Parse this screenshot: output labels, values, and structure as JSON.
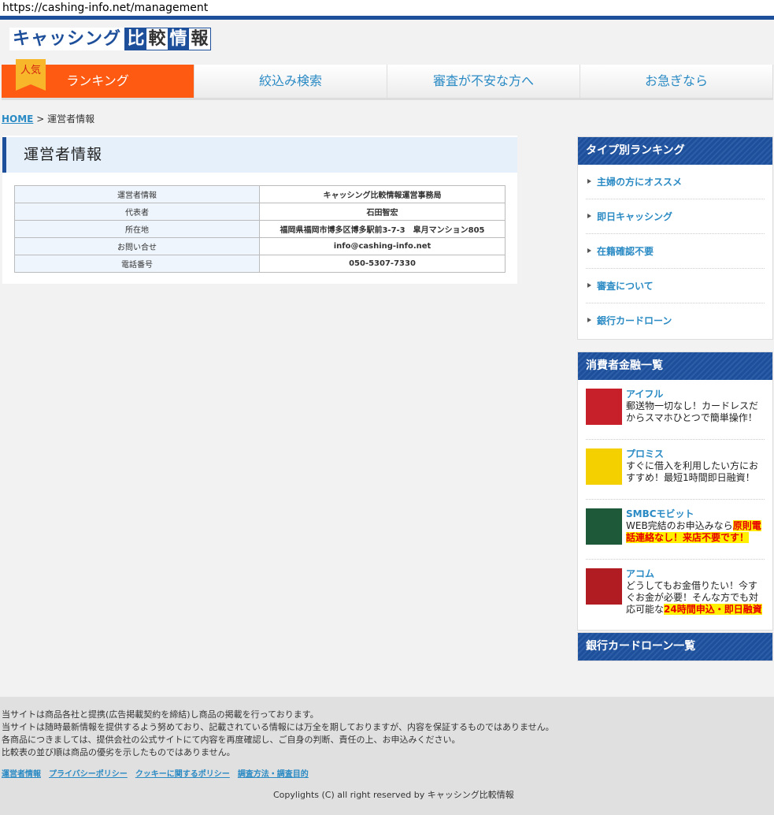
{
  "url": "https://cashing-info.net/management",
  "logo": {
    "text": "キャッシング",
    "boxes": [
      "比",
      "較",
      "情",
      "報"
    ]
  },
  "nav": {
    "badge": "人気",
    "items": [
      "ランキング",
      "絞込み検索",
      "審査が不安な方へ",
      "お急ぎなら"
    ]
  },
  "breadcrumb": {
    "home": "HOME",
    "separator": ">",
    "current": "運営者情報"
  },
  "main": {
    "title": "運営者情報",
    "rows": [
      {
        "label": "運営者情報",
        "value": "キャッシング比較情報運営事務局"
      },
      {
        "label": "代表者",
        "value": "石田智宏"
      },
      {
        "label": "所在地",
        "value": "福岡県福岡市博多区博多駅前3-7-3　皐月マンション805"
      },
      {
        "label": "お問い合せ",
        "value": "info@cashing-info.net"
      },
      {
        "label": "電話番号",
        "value": "050-5307-7330"
      }
    ]
  },
  "sidebar": {
    "type_ranking": {
      "title": "タイプ別ランキング",
      "items": [
        "主婦の方にオススメ",
        "即日キャッシング",
        "在籍確認不要",
        "審査について",
        "銀行カードローン"
      ]
    },
    "consumer": {
      "title": "消費者金融一覧",
      "items": [
        {
          "name": "アイフル",
          "desc": "郵送物一切なし！カードレスだからスマホひとつで簡単操作！",
          "highlight": "",
          "thumb_color": "#c8202a"
        },
        {
          "name": "プロミス",
          "desc": "すぐに借入を利用したい方におすすめ！最短1時間即日融資！",
          "highlight": "",
          "thumb_color": "#f5d000"
        },
        {
          "name": "SMBCモビット",
          "desc": "WEB完結のお申込みなら",
          "highlight": "原則電話連絡なし！来店不要です！",
          "thumb_color": "#1e5a3a"
        },
        {
          "name": "アコム",
          "desc": "どうしてもお金借りたい！今すぐお金が必要！そんな方でも対応可能な",
          "highlight": "24時間申込・即日融資",
          "thumb_color": "#b01c22"
        }
      ]
    },
    "bank": {
      "title": "銀行カードローン一覧"
    }
  },
  "footer": {
    "lines": [
      "当サイトは商品各社と提携(広告掲載契約を締結)し商品の掲載を行っております。",
      "当サイトは随時最新情報を提供するよう努めており、記載されている情報には万全を期しておりますが、内容を保証するものではありません。",
      "各商品につきましては、提供会社の公式サイトにて内容を再度確認し、ご自身の判断、責任の上、お申込みください。",
      "比較表の並び順は商品の優劣を示したものではありません。"
    ],
    "links": [
      "運営者情報",
      "プライバシーポリシー",
      "クッキーに関するポリシー",
      "調査方法・調査目的"
    ],
    "copyright": "Copylights (C) all right reserved by キャッシング比較情報"
  }
}
